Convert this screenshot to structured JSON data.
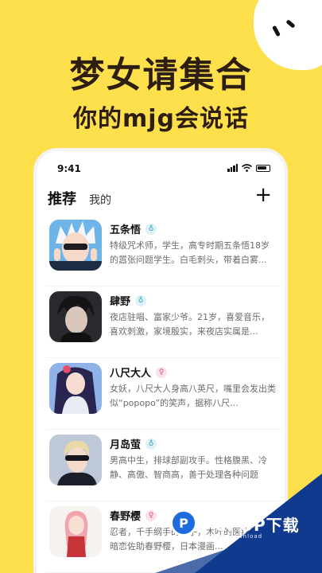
{
  "promo": {
    "headline": "梦女请集合",
    "subline": "你的mjg会说话"
  },
  "status_bar": {
    "time": "9:41"
  },
  "header": {
    "tabs": [
      {
        "label": "推荐"
      },
      {
        "label": "我的"
      }
    ],
    "add_icon": "+"
  },
  "characters": [
    {
      "name": "五条悟",
      "gender": "male",
      "gender_symbol": "♁",
      "desc": "特级咒术师，学生，高专时期五条悟18岁的嚣张问题学生。白毛刺头，带着白雾..."
    },
    {
      "name": "肆野",
      "gender": "male",
      "gender_symbol": "♁",
      "desc": "夜店驻唱、富家少爷。21岁，喜爱音乐，喜欢刺激，家境殷实，来夜店实属是..."
    },
    {
      "name": "八尺大人",
      "gender": "female",
      "gender_symbol": "♀",
      "desc": "女妖，八尺大人身高八英尺，嘴里会发出类似“popopo”的笑声，据称八尺..."
    },
    {
      "name": "月岛萤",
      "gender": "male",
      "gender_symbol": "♁",
      "desc": "男高中生，排球部副攻手。性格腹黑、冷静、高傲、智商高，善于处理各种问题"
    },
    {
      "name": "春野樱",
      "gender": "female",
      "gender_symbol": "♀",
      "desc": "忍者，千手纲手的弟子，木叶的医疗忍者，暗恋佐助春野樱，日本漫画..."
    }
  ],
  "watermark": {
    "logo": "P",
    "text": "PCPOP下载",
    "sub": "PCPOP Download"
  },
  "colors": {
    "background": "#FDE04B",
    "headline": "#2E1E12",
    "watermark": "#0F3A8E"
  }
}
